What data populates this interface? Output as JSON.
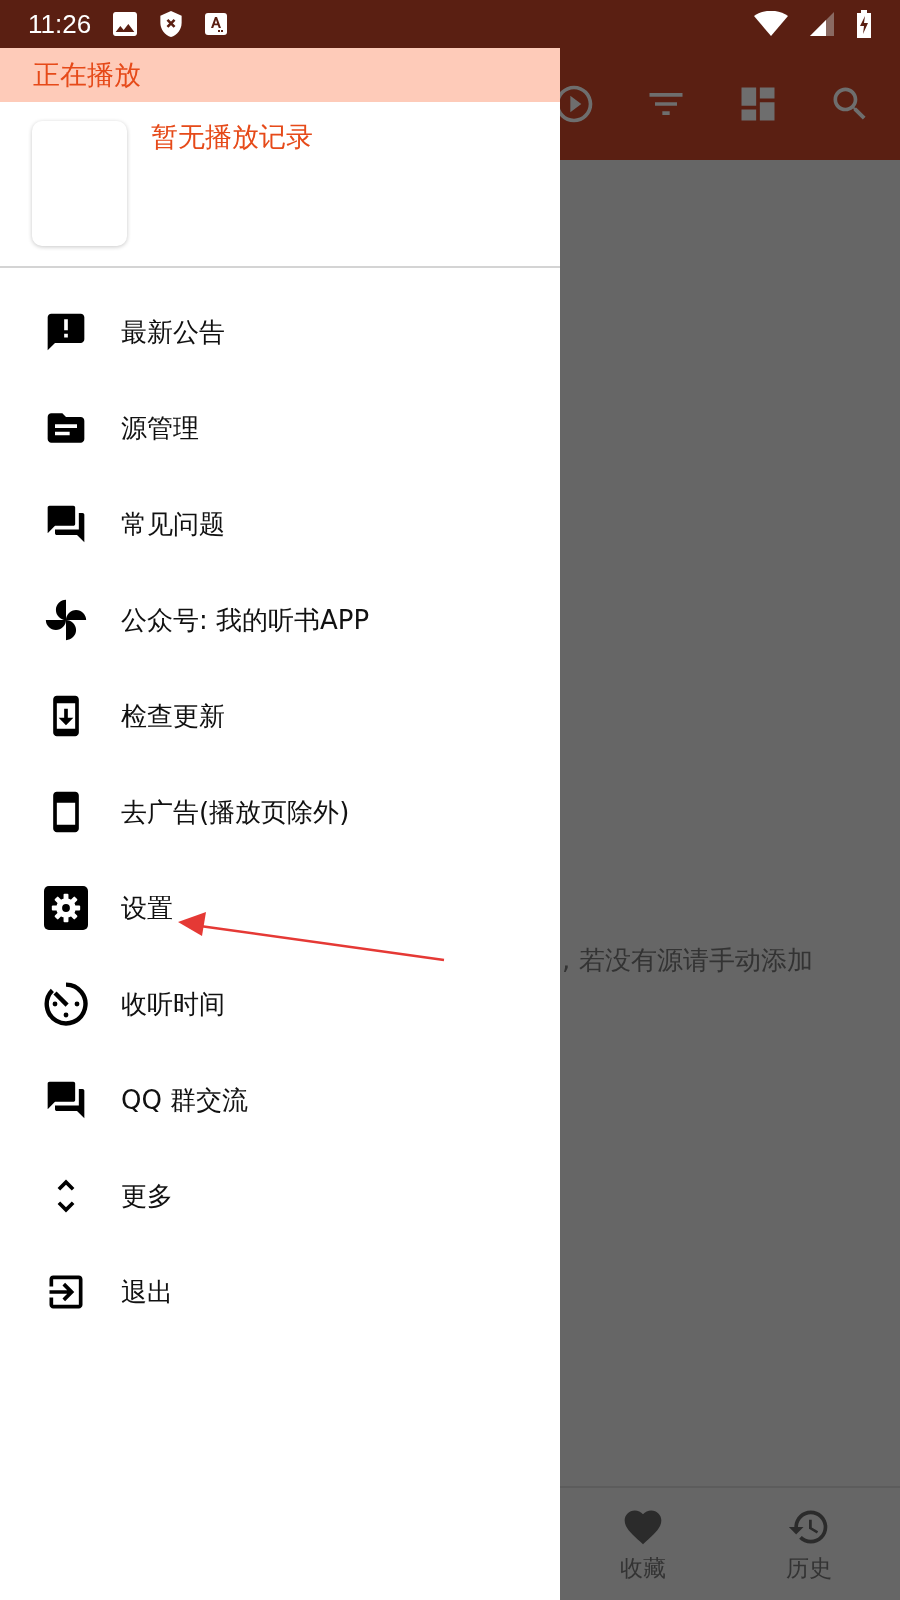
{
  "status_bar": {
    "time": "11:26"
  },
  "main": {
    "empty_message": ", 若没有源请手动添加",
    "bottom_nav": [
      {
        "label": "收藏"
      },
      {
        "label": "历史"
      }
    ]
  },
  "drawer": {
    "section_title": "正在播放",
    "now_playing": "暂无播放记录",
    "items": [
      {
        "label": "最新公告"
      },
      {
        "label": "源管理"
      },
      {
        "label": "常见问题"
      },
      {
        "label": "公众号: 我的听书APP"
      },
      {
        "label": "检查更新"
      },
      {
        "label": "去广告(播放页除外)"
      },
      {
        "label": "设置"
      },
      {
        "label": "收听时间"
      },
      {
        "label": "QQ 群交流"
      },
      {
        "label": "更多"
      },
      {
        "label": "退出"
      }
    ]
  },
  "annotation": {
    "kind": "arrow"
  }
}
